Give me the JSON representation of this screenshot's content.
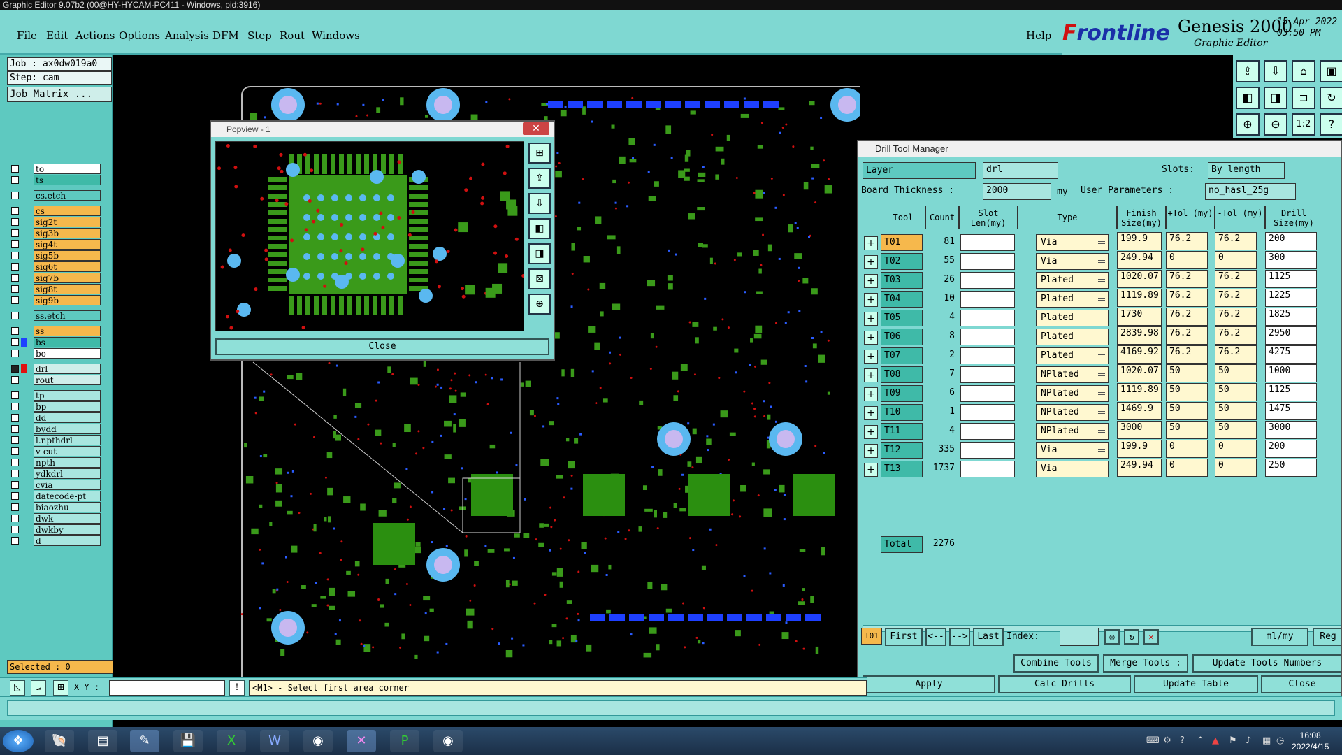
{
  "window": {
    "title": "Graphic Editor 9.07b2 (00@HY-HYCAM-PC411 - Windows, pid:3916)"
  },
  "menu": {
    "items": [
      "File",
      "Edit",
      "Actions",
      "Options",
      "Analysis",
      "DFM",
      "Step",
      "Rout",
      "Windows"
    ],
    "help": "Help"
  },
  "brand": {
    "logo_first": "F",
    "logo_rest": "rontline",
    "product": "Genesis 2000",
    "subtitle": "Graphic Editor",
    "date": "15 Apr 2022",
    "time": "03:50 PM"
  },
  "job": {
    "job": "Job : ax0dw019a0",
    "step": "Step: cam",
    "matrix": "Job Matrix ..."
  },
  "layers": [
    {
      "name": "to",
      "color": "#ffffff",
      "swatch": "",
      "selected": false
    },
    {
      "name": "ts",
      "color": "#3fbaa8",
      "swatch": "",
      "selected": false
    },
    {
      "name": "cs.etch",
      "color": "#5ec9c0",
      "swatch": "",
      "selected": false
    },
    {
      "name": "cs",
      "color": "#f6b84c",
      "swatch": "",
      "selected": false
    },
    {
      "name": "sig2t",
      "color": "#f6b84c",
      "swatch": "",
      "selected": false
    },
    {
      "name": "sig3b",
      "color": "#f6b84c",
      "swatch": "",
      "selected": false
    },
    {
      "name": "sig4t",
      "color": "#f6b84c",
      "swatch": "",
      "selected": false
    },
    {
      "name": "sig5b",
      "color": "#f6b84c",
      "swatch": "",
      "selected": false
    },
    {
      "name": "sig6t",
      "color": "#f6b84c",
      "swatch": "",
      "selected": false
    },
    {
      "name": "sig7b",
      "color": "#f6b84c",
      "swatch": "",
      "selected": false
    },
    {
      "name": "sig8t",
      "color": "#f6b84c",
      "swatch": "",
      "selected": false
    },
    {
      "name": "sig9b",
      "color": "#f6b84c",
      "swatch": "",
      "selected": false
    },
    {
      "name": "ss.etch",
      "color": "#5ec9c0",
      "swatch": "",
      "selected": false
    },
    {
      "name": "ss",
      "color": "#f6b84c",
      "swatch": "",
      "selected": false
    },
    {
      "name": "bs",
      "color": "#3fbaa8",
      "swatch": "#1e40ff",
      "selected": false
    },
    {
      "name": "bo",
      "color": "#ffffff",
      "swatch": "",
      "selected": false
    },
    {
      "name": "drl",
      "color": "#cfeeea",
      "swatch": "#e01010",
      "selected": true
    },
    {
      "name": "rout",
      "color": "#cfeeea",
      "swatch": "",
      "selected": false
    },
    {
      "name": "tp",
      "color": "#a8e6e0",
      "swatch": "",
      "selected": false
    },
    {
      "name": "bp",
      "color": "#a8e6e0",
      "swatch": "",
      "selected": false
    },
    {
      "name": "dd",
      "color": "#a8e6e0",
      "swatch": "",
      "selected": false
    },
    {
      "name": "bydd",
      "color": "#a8e6e0",
      "swatch": "",
      "selected": false
    },
    {
      "name": "l.npthdrl",
      "color": "#a8e6e0",
      "swatch": "",
      "selected": false
    },
    {
      "name": "v-cut",
      "color": "#a8e6e0",
      "swatch": "",
      "selected": false
    },
    {
      "name": "npth",
      "color": "#a8e6e0",
      "swatch": "",
      "selected": false
    },
    {
      "name": "ydkdrl",
      "color": "#a8e6e0",
      "swatch": "",
      "selected": false
    },
    {
      "name": "cvia",
      "color": "#a8e6e0",
      "swatch": "",
      "selected": false
    },
    {
      "name": "datecode-pt",
      "color": "#a8e6e0",
      "swatch": "",
      "selected": false
    },
    {
      "name": "biaozhu",
      "color": "#a8e6e0",
      "swatch": "",
      "selected": false
    },
    {
      "name": "dwk",
      "color": "#a8e6e0",
      "swatch": "",
      "selected": false
    },
    {
      "name": "dwkby",
      "color": "#a8e6e0",
      "swatch": "",
      "selected": false
    },
    {
      "name": "d",
      "color": "#a8e6e0",
      "swatch": "",
      "selected": false
    }
  ],
  "status": {
    "selected": "Selected : 0",
    "xy_label": "X Y :",
    "message": "<M1> - Select first area corner"
  },
  "popview": {
    "title": "Popview - 1",
    "close": "Close"
  },
  "dtm": {
    "title": "Drill Tool Manager",
    "layer_label": "Layer",
    "layer_value": "drl",
    "slots_label": "Slots:",
    "slots_value": "By length",
    "board_thickness_label": "Board Thickness :",
    "board_thickness_value": "2000",
    "board_thickness_unit": "my",
    "user_params_label": "User Parameters :",
    "user_params_value": "no_hasl_25g",
    "headers": {
      "tool": "Tool",
      "count": "Count",
      "slot": "Slot Len(my)",
      "type": "Type",
      "finish": "Finish Size(my)",
      "ptol": "+Tol (my)",
      "mtol": "-Tol (my)",
      "drill": "Drill Size(my)"
    },
    "rows": [
      {
        "tool": "T01",
        "count": "81",
        "type": "Via",
        "finish": "199.9",
        "ptol": "76.2",
        "mtol": "76.2",
        "drill": "200"
      },
      {
        "tool": "T02",
        "count": "55",
        "type": "Via",
        "finish": "249.94",
        "ptol": "0",
        "mtol": "0",
        "drill": "300"
      },
      {
        "tool": "T03",
        "count": "26",
        "type": "Plated",
        "finish": "1020.07",
        "ptol": "76.2",
        "mtol": "76.2",
        "drill": "1125"
      },
      {
        "tool": "T04",
        "count": "10",
        "type": "Plated",
        "finish": "1119.89",
        "ptol": "76.2",
        "mtol": "76.2",
        "drill": "1225"
      },
      {
        "tool": "T05",
        "count": "4",
        "type": "Plated",
        "finish": "1730",
        "ptol": "76.2",
        "mtol": "76.2",
        "drill": "1825"
      },
      {
        "tool": "T06",
        "count": "8",
        "type": "Plated",
        "finish": "2839.98",
        "ptol": "76.2",
        "mtol": "76.2",
        "drill": "2950"
      },
      {
        "tool": "T07",
        "count": "2",
        "type": "Plated",
        "finish": "4169.92",
        "ptol": "76.2",
        "mtol": "76.2",
        "drill": "4275"
      },
      {
        "tool": "T08",
        "count": "7",
        "type": "NPlated",
        "finish": "1020.07",
        "ptol": "50",
        "mtol": "50",
        "drill": "1000"
      },
      {
        "tool": "T09",
        "count": "6",
        "type": "NPlated",
        "finish": "1119.89",
        "ptol": "50",
        "mtol": "50",
        "drill": "1125"
      },
      {
        "tool": "T10",
        "count": "1",
        "type": "NPlated",
        "finish": "1469.9",
        "ptol": "50",
        "mtol": "50",
        "drill": "1475"
      },
      {
        "tool": "T11",
        "count": "4",
        "type": "NPlated",
        "finish": "3000",
        "ptol": "50",
        "mtol": "50",
        "drill": "3000"
      },
      {
        "tool": "T12",
        "count": "335",
        "type": "Via",
        "finish": "199.9",
        "ptol": "0",
        "mtol": "0",
        "drill": "200"
      },
      {
        "tool": "T13",
        "count": "1737",
        "type": "Via",
        "finish": "249.94",
        "ptol": "0",
        "mtol": "0",
        "drill": "250"
      }
    ],
    "total_label": "Total",
    "total_value": "2276",
    "nav": {
      "current": "T01",
      "first": "First",
      "prev": "<--",
      "next": "-->",
      "last": "Last",
      "index": "Index:",
      "units": "ml/my",
      "reg": "Reg"
    },
    "actions": {
      "combine": "Combine Tools",
      "merge": "Merge Tools :",
      "update_numbers": "Update Tools Numbers",
      "apply": "Apply",
      "calc": "Calc Drills",
      "update_table": "Update Table",
      "close": "Close"
    }
  },
  "taskbar": {
    "time": "16:08",
    "date": "2022/4/15"
  }
}
